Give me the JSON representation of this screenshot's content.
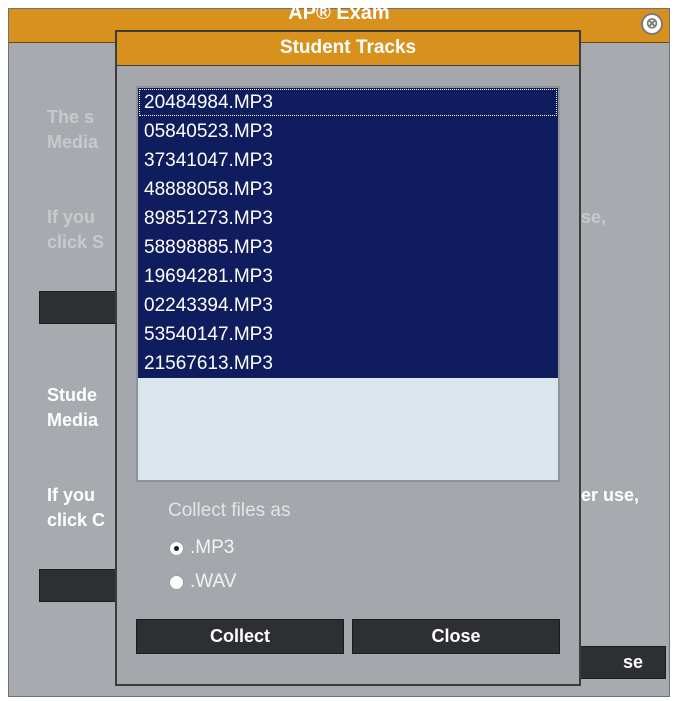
{
  "background": {
    "title": "AP® Exam",
    "close_glyph": "⊗",
    "para1": [
      "The s",
      "Media"
    ],
    "para2": [
      "If you",
      "click S"
    ],
    "para2_right": "se,",
    "para3": [
      "Stude",
      "Media"
    ],
    "para4": [
      "If you",
      "click C"
    ],
    "para4_right": "er use,",
    "close_button_label": "se"
  },
  "modal": {
    "title": "Student Tracks",
    "tracks": [
      "20484984.MP3",
      "05840523.MP3",
      "37341047.MP3",
      "48888058.MP3",
      "89851273.MP3",
      "58898885.MP3",
      "19694281.MP3",
      "02243394.MP3",
      "53540147.MP3",
      "21567613.MP3"
    ],
    "collect_label": "Collect files as",
    "format_options": [
      {
        "label": ".MP3",
        "checked": true
      },
      {
        "label": ".WAV",
        "checked": false
      }
    ],
    "collect_button": "Collect",
    "close_button": "Close"
  },
  "colors": {
    "title_bar": "#d9911d",
    "selection": "#0f1d5e",
    "dialog_bg": "#a4a7ab",
    "button_bg": "#2d2f33"
  }
}
